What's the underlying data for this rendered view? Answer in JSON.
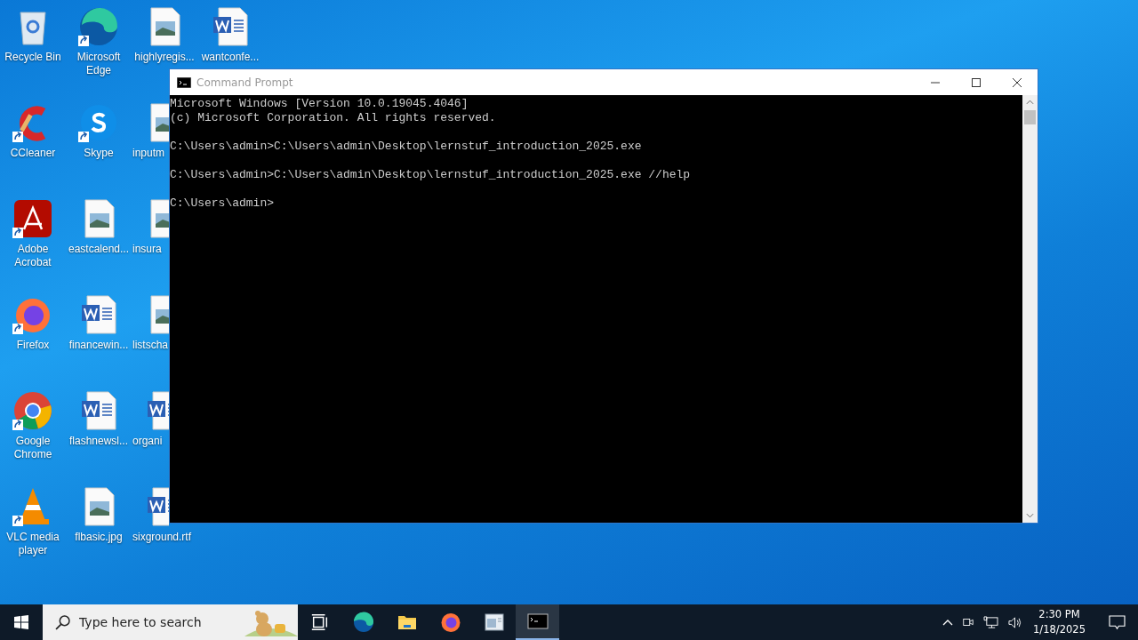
{
  "desktop_icons": [
    {
      "label": "Recycle Bin",
      "kind": "recycle",
      "shortcut": false,
      "cut": false
    },
    {
      "label": "CCleaner",
      "kind": "ccleaner",
      "shortcut": true,
      "cut": false
    },
    {
      "label": "Adobe Acrobat",
      "kind": "acrobat",
      "shortcut": true,
      "cut": false
    },
    {
      "label": "Firefox",
      "kind": "firefox",
      "shortcut": true,
      "cut": false
    },
    {
      "label": "Google Chrome",
      "kind": "chrome",
      "shortcut": true,
      "cut": false
    },
    {
      "label": "VLC media player",
      "kind": "vlc",
      "shortcut": true,
      "cut": false
    },
    {
      "label": "Microsoft Edge",
      "kind": "edge",
      "shortcut": true,
      "cut": false
    },
    {
      "label": "Skype",
      "kind": "skype",
      "shortcut": true,
      "cut": false
    },
    {
      "label": "eastcalend...",
      "kind": "image",
      "shortcut": false,
      "cut": false
    },
    {
      "label": "financewin...",
      "kind": "word",
      "shortcut": false,
      "cut": false
    },
    {
      "label": "flashnewsl...",
      "kind": "word",
      "shortcut": false,
      "cut": false
    },
    {
      "label": "flbasic.jpg",
      "kind": "image",
      "shortcut": false,
      "cut": false
    },
    {
      "label": "highlyregis...",
      "kind": "image",
      "shortcut": false,
      "cut": false
    },
    {
      "label": "inputm",
      "kind": "image",
      "shortcut": false,
      "cut": true
    },
    {
      "label": "insura",
      "kind": "image",
      "shortcut": false,
      "cut": true
    },
    {
      "label": "listscha",
      "kind": "image",
      "shortcut": false,
      "cut": true
    },
    {
      "label": "organi",
      "kind": "word",
      "shortcut": false,
      "cut": true
    },
    {
      "label": "sixground.rtf",
      "kind": "word",
      "shortcut": false,
      "cut": true
    },
    {
      "label": "wantconfe...",
      "kind": "word",
      "shortcut": false,
      "cut": false
    }
  ],
  "window": {
    "title": "Command Prompt",
    "console_blocks": [
      [
        "Microsoft Windows [Version 10.0.19045.4046]",
        "(c) Microsoft Corporation. All rights reserved."
      ],
      [
        "C:\\Users\\admin>C:\\Users\\admin\\Desktop\\lernstuf_introduction_2025.exe"
      ],
      [
        "C:\\Users\\admin>C:\\Users\\admin\\Desktop\\lernstuf_introduction_2025.exe //help"
      ],
      [
        "C:\\Users\\admin>"
      ]
    ]
  },
  "taskbar": {
    "search": {
      "placeholder": "Type here to search"
    },
    "apps": [
      {
        "kind": "taskview",
        "selected": false
      },
      {
        "kind": "edge",
        "selected": false
      },
      {
        "kind": "explorer",
        "selected": false
      },
      {
        "kind": "firefox",
        "selected": false
      },
      {
        "kind": "app",
        "selected": false
      },
      {
        "kind": "cmd",
        "selected": true
      }
    ],
    "time": "2:30 PM",
    "date": "1/18/2025"
  }
}
